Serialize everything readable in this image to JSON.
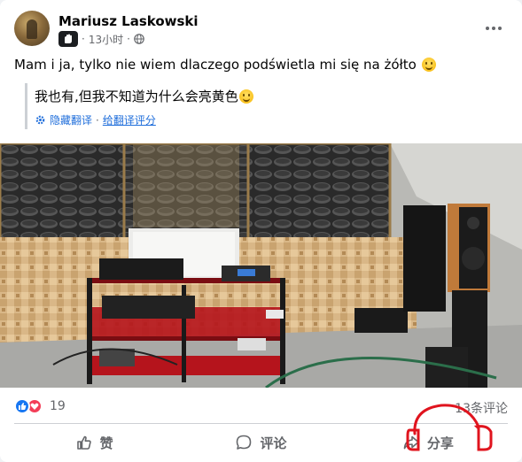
{
  "post": {
    "author": "Mariusz Laskowski",
    "time": "13小时",
    "audience_icon": "globe-icon",
    "text": "Mam i ja, tylko nie wiem dlaczego podświetla mi się na żółto",
    "translation": {
      "text": "我也有,但我不知道为什么会亮黄色",
      "hide_link": "隐藏翻译",
      "separator": "·",
      "rate_link": "给翻译评分"
    }
  },
  "stats": {
    "reaction_count": "19",
    "comments": "13条评论",
    "reaction_icons": [
      "like-icon",
      "love-icon"
    ]
  },
  "actions": {
    "like": "赞",
    "comment": "评论",
    "share": "分享"
  },
  "colors": {
    "brand_blue": "#1877f2",
    "link": "#216fdb",
    "secondary_text": "#65676b",
    "annotation_red": "#e0141e"
  }
}
